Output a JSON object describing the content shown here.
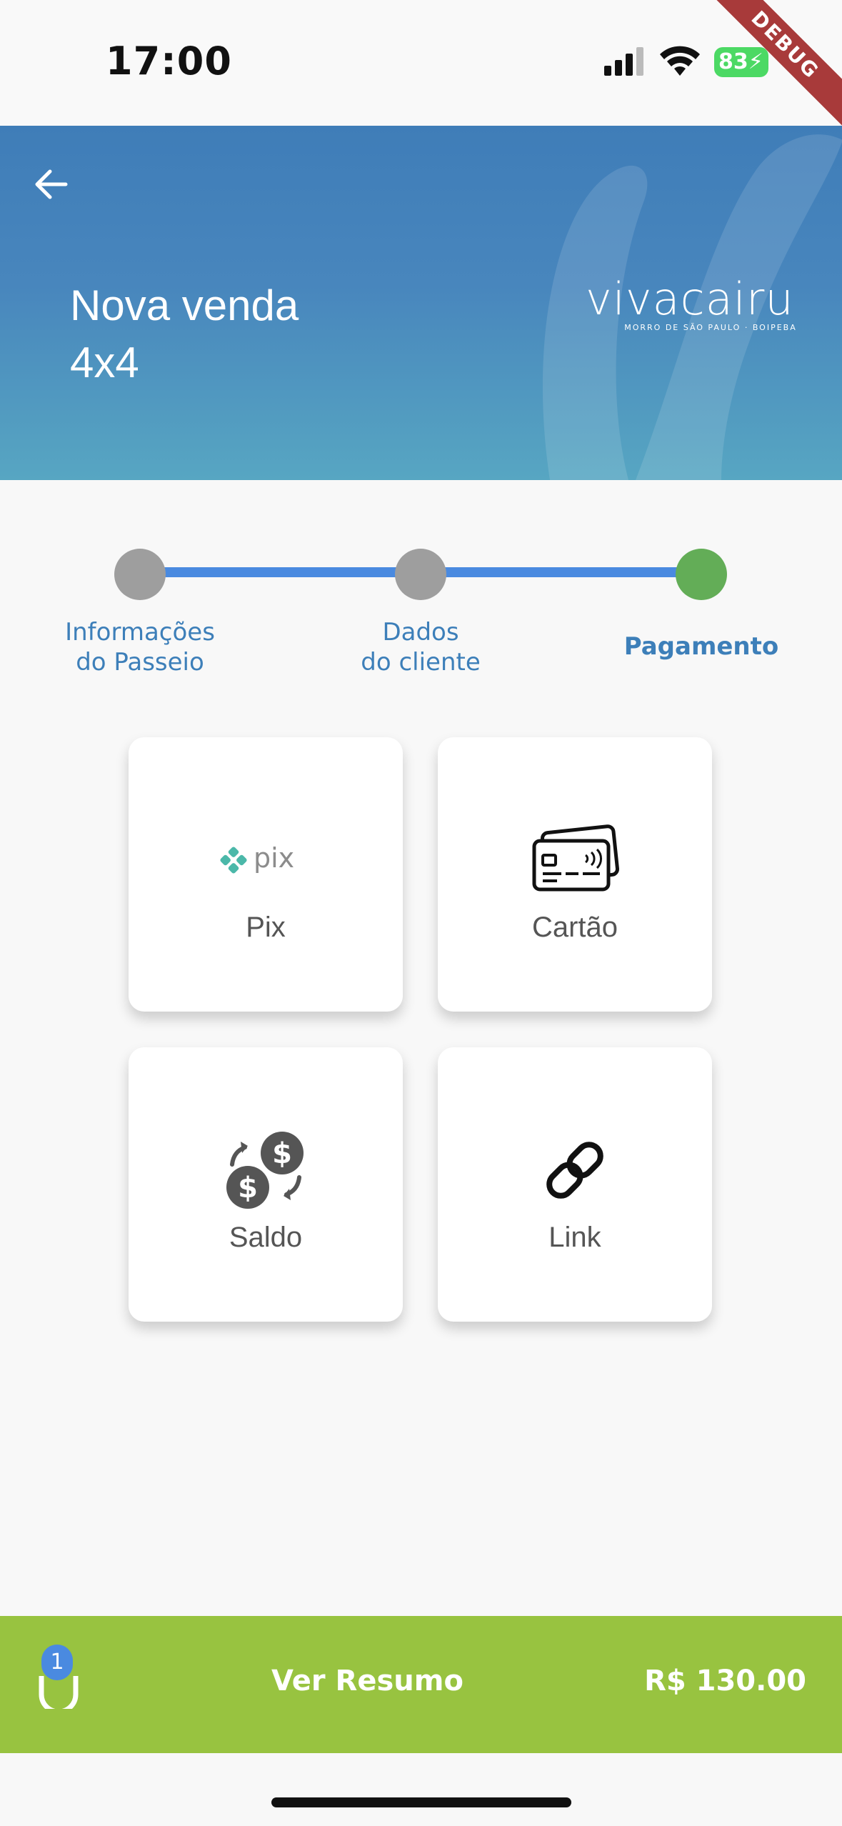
{
  "status_bar": {
    "time": "17:00",
    "battery": "83",
    "debug_label": "DEBUG"
  },
  "header": {
    "title_line1": "Nova venda",
    "title_line2": "4x4",
    "logo_text": "vivacairu",
    "logo_subtitle": "MORRO DE SÃO PAULO · BOIPEBA"
  },
  "stepper": {
    "steps": [
      {
        "line1": "Informações",
        "line2": "do Passeio",
        "state": "done"
      },
      {
        "line1": "Dados",
        "line2": "do cliente",
        "state": "done"
      },
      {
        "line1": "Pagamento",
        "line2": "",
        "state": "active"
      }
    ]
  },
  "payment_options": [
    {
      "label": "Pix",
      "icon": "pix-logo-icon",
      "logo_text": "pix"
    },
    {
      "label": "Cartão",
      "icon": "credit-card-icon"
    },
    {
      "label": "Saldo",
      "icon": "currency-exchange-icon"
    },
    {
      "label": "Link",
      "icon": "link-icon"
    }
  ],
  "bottom_bar": {
    "cart_count": "1",
    "summary_label": "Ver Resumo",
    "total": "R$ 130.00"
  },
  "colors": {
    "header_top": "#3f7db8",
    "header_bottom": "#57a6c2",
    "accent_blue": "#4a8ae0",
    "step_active": "#63ad57",
    "bottom_bar": "#98c340"
  }
}
